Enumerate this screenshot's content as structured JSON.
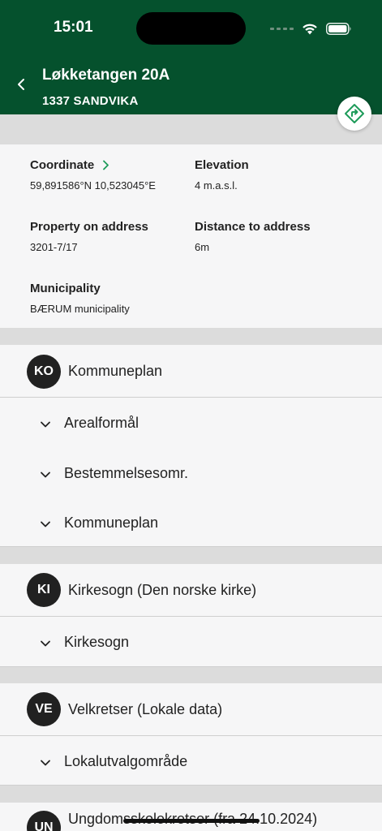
{
  "status_bar": {
    "time": "15:01"
  },
  "header": {
    "title": "Løkketangen 20A",
    "subtitle": "1337 SANDVIKA"
  },
  "info": {
    "coordinate": {
      "label": "Coordinate",
      "value": "59,891586°N  10,523045°E"
    },
    "elevation": {
      "label": "Elevation",
      "value": "4 m.a.s.l."
    },
    "property": {
      "label": "Property on address",
      "value": "3201-7/17"
    },
    "distance": {
      "label": "Distance to address",
      "value": "6m"
    },
    "municipality": {
      "label": "Municipality",
      "value": "BÆRUM municipality"
    }
  },
  "sections": [
    {
      "badge": "KO",
      "title": "Kommuneplan",
      "items": [
        "Arealformål",
        "Bestemmelsesomr.",
        "Kommuneplan"
      ]
    },
    {
      "badge": "KI",
      "title": "Kirkesogn (Den norske kirke)",
      "items": [
        "Kirkesogn"
      ]
    },
    {
      "badge": "VE",
      "title": "Velkretser (Lokale data)",
      "items": [
        "Lokalutvalgområde"
      ]
    },
    {
      "badge": "UN",
      "title": "Ungdomsskolekretser (fra 24.10.2024)",
      "items": []
    }
  ],
  "colors": {
    "header_green": "#05512d",
    "accent_green": "#1e9b5a"
  }
}
